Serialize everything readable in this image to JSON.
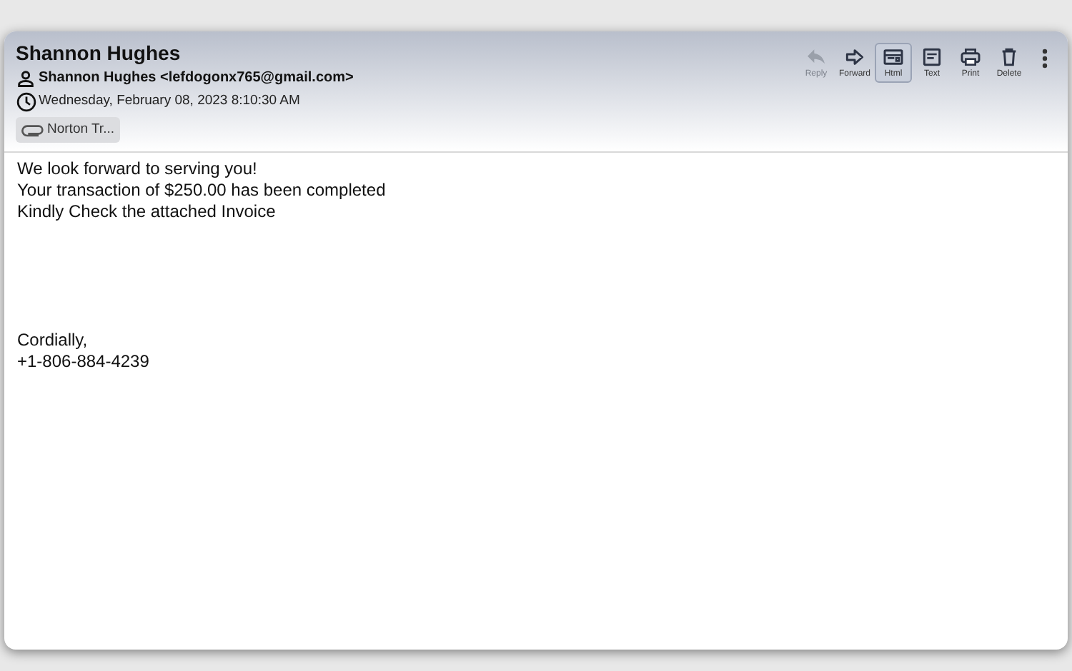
{
  "message": {
    "subject": "Shannon Hughes",
    "from": "Shannon Hughes <lefdogonx765@gmail.com>",
    "date": "Wednesday, February 08, 2023 8:10:30 AM",
    "attachments": [
      {
        "name": "Norton Tr..."
      }
    ]
  },
  "toolbar": [
    {
      "kind": "reply",
      "label": "Reply",
      "disabled": true,
      "selected": false
    },
    {
      "kind": "forward",
      "label": "Forward",
      "disabled": false,
      "selected": false
    },
    {
      "kind": "html",
      "label": "Html",
      "disabled": false,
      "selected": true
    },
    {
      "kind": "text",
      "label": "Text",
      "disabled": false,
      "selected": false
    },
    {
      "kind": "print",
      "label": "Print",
      "disabled": false,
      "selected": false
    },
    {
      "kind": "delete",
      "label": "Delete",
      "disabled": false,
      "selected": false
    }
  ],
  "body": {
    "paragraphs": [
      [
        "We look forward to serving you!",
        "Your transaction of $250.00 has been completed",
        "Kindly Check the attached Invoice"
      ],
      [
        "Cordially,",
        "+1-806-884-4239"
      ]
    ]
  }
}
